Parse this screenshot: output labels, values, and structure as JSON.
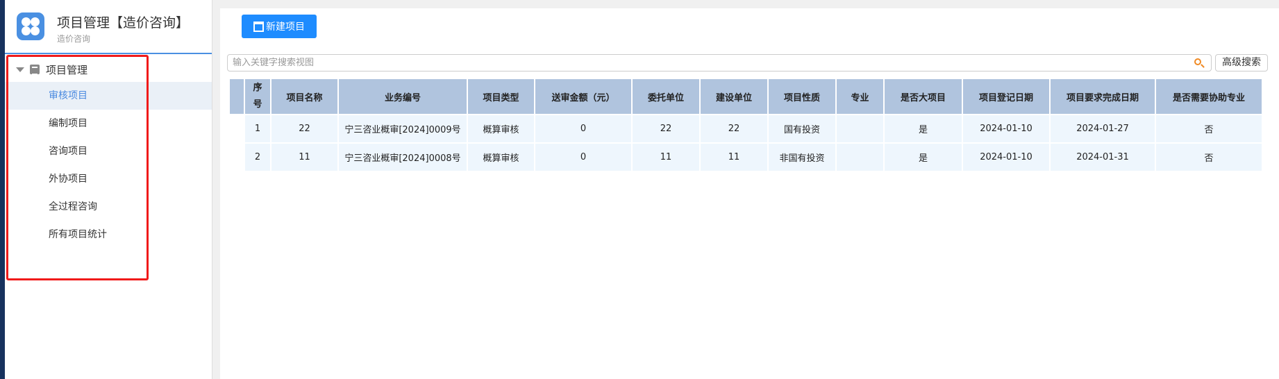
{
  "app": {
    "title": "项目管理【造价咨询】",
    "subtitle": "造价咨询"
  },
  "sidebar": {
    "group": "项目管理",
    "items": [
      {
        "label": "审核项目",
        "active": true
      },
      {
        "label": "编制项目"
      },
      {
        "label": "咨询项目"
      },
      {
        "label": "外协项目"
      },
      {
        "label": "全过程咨询"
      },
      {
        "label": "所有项目统计"
      }
    ]
  },
  "toolbar": {
    "new_label": "新建项目",
    "search_placeholder": "输入关键字搜索视图",
    "advanced_label": "高级搜索"
  },
  "table": {
    "headers": [
      "序号",
      "项目名称",
      "业务编号",
      "项目类型",
      "送审金额（元）",
      "委托单位",
      "建设单位",
      "项目性质",
      "专业",
      "是否大项目",
      "项目登记日期",
      "项目要求完成日期",
      "是否需要协助专业"
    ],
    "rows": [
      [
        "1",
        "22",
        "宁三咨业概审[2024]0009号",
        "概算审核",
        "0",
        "22",
        "22",
        "国有投资",
        "",
        "是",
        "2024-01-10",
        "2024-01-27",
        "否"
      ],
      [
        "2",
        "11",
        "宁三咨业概审[2024]0008号",
        "概算审核",
        "0",
        "11",
        "11",
        "非国有投资",
        "",
        "是",
        "2024-01-10",
        "2024-01-31",
        "否"
      ]
    ]
  }
}
